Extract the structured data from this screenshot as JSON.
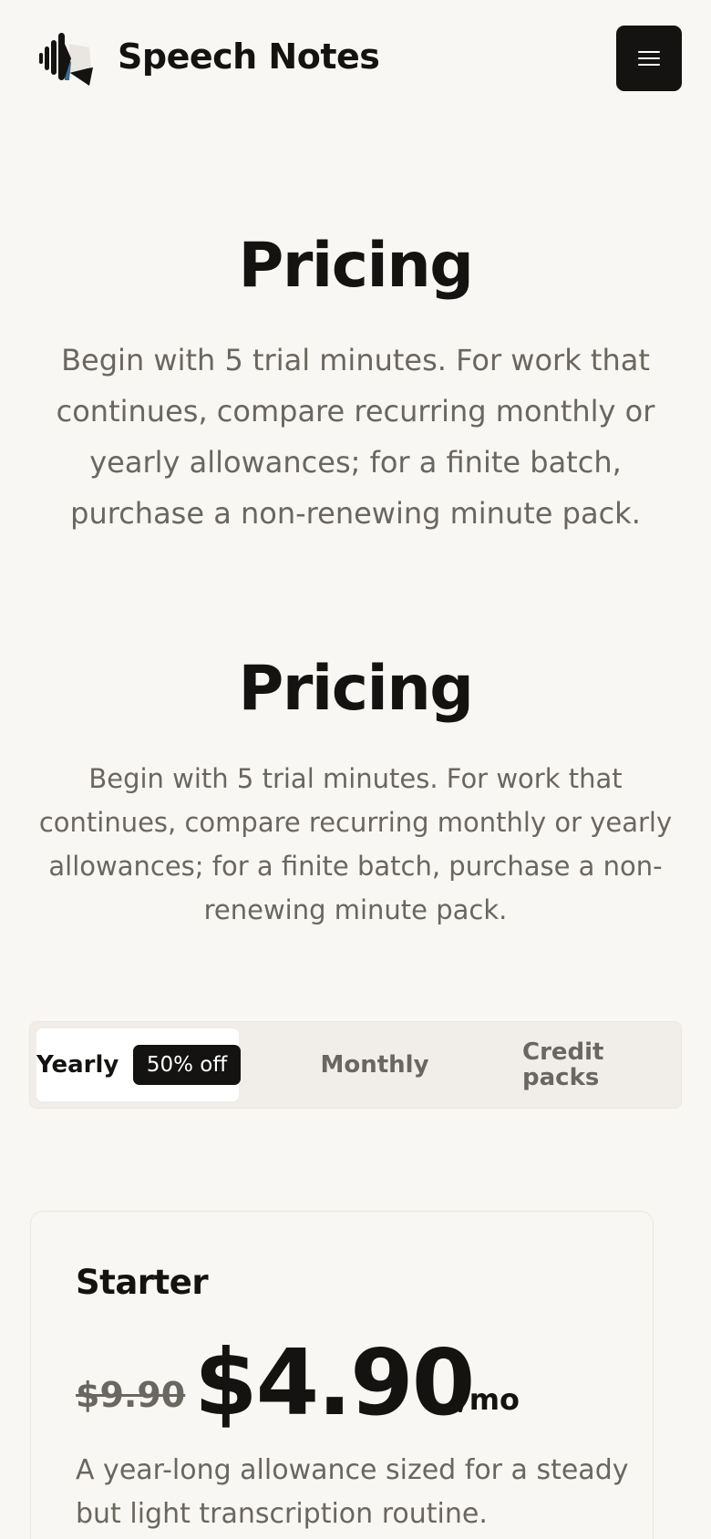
{
  "header": {
    "brand": "Speech Notes",
    "menu_icon": "hamburger-menu-icon",
    "logo_icon": "speech-waveform-logo-icon"
  },
  "hero_primary": {
    "title": "Pricing",
    "description": "Begin with 5 trial minutes. For work that continues, compare recurring monthly or yearly allowances; for a finite batch, purchase a non-renewing minute pack."
  },
  "hero_secondary": {
    "title": "Pricing",
    "description": "Begin with 5 trial minutes. For work that continues, compare recurring monthly or yearly allowances; for a finite batch, purchase a non-renewing minute pack."
  },
  "billing_tabs": {
    "selected": "Yearly",
    "items": [
      {
        "label": "Yearly",
        "badge": "50% off"
      },
      {
        "label": "Monthly"
      },
      {
        "label": "Credit packs"
      }
    ]
  },
  "plan": {
    "name": "Starter",
    "old_price": "$9.90",
    "price": "$4.90",
    "period": "/mo",
    "description": "A year-long allowance sized for a steady but light transcription routine."
  },
  "colors": {
    "background": "#f9f7f3",
    "text": "#141311",
    "muted": "#6a6660",
    "tab_track": "#f1eee9",
    "accent_dark": "#141311"
  }
}
